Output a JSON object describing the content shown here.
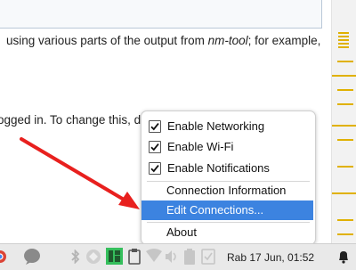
{
  "document": {
    "line1_before": "using various parts of the output from ",
    "line1_italic": "nm-tool",
    "line1_after": "; for example,",
    "line2": "ogged in. To change this, do"
  },
  "context_menu": {
    "items": [
      {
        "label": "Enable Networking",
        "checked": true
      },
      {
        "label": "Enable Wi-Fi",
        "checked": true
      },
      {
        "label": "Enable Notifications",
        "checked": true
      },
      {
        "label": "Connection Information"
      },
      {
        "label": "Edit Connections..."
      },
      {
        "label": "About"
      }
    ],
    "highlighted": "Edit Connections..."
  },
  "taskbar": {
    "clock": "Rab 17 Jun, 01:52",
    "icons": [
      "chrome-icon",
      "chat-icon",
      "bluetooth-icon",
      "network-icon",
      "manjaro-icon",
      "clipboard-icon",
      "wifi-icon",
      "volume-icon",
      "battery-icon",
      "keyboard-icon",
      "bell-icon"
    ]
  },
  "colors": {
    "highlight": "#3c83e0",
    "arrow": "#e8201e",
    "scroll_marker": "#e0b100"
  }
}
